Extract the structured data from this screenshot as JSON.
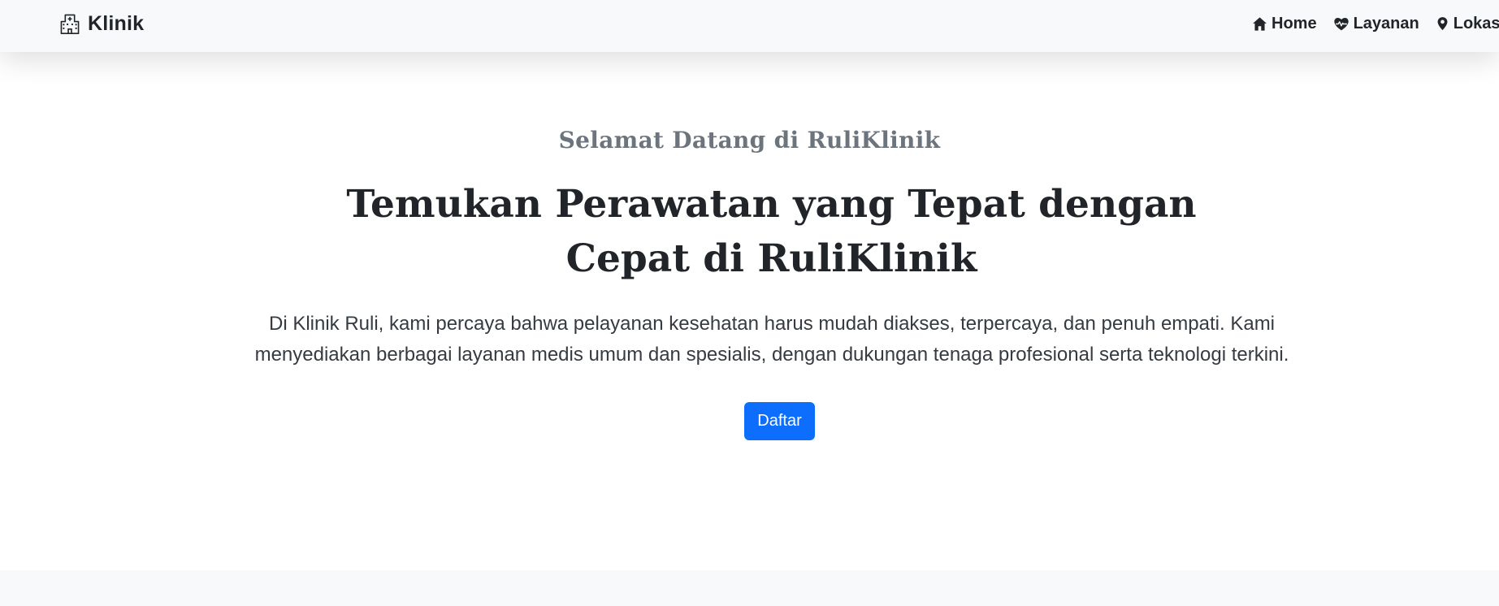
{
  "navbar": {
    "brand": {
      "label": "Klinik",
      "icon": "hospital-icon"
    },
    "items": [
      {
        "label": "Home",
        "icon": "house-icon"
      },
      {
        "label": "Layanan",
        "icon": "heart-pulse-icon"
      },
      {
        "label": "Lokasi",
        "icon": "geo-pin-icon"
      }
    ]
  },
  "hero": {
    "kicker": "Selamat Datang di RuliKlinik",
    "headline": "Temukan Perawatan yang Tepat dengan Cepat di RuliKlinik",
    "lead": "Di Klinik Ruli, kami percaya bahwa pelayanan kesehatan harus mudah diakses, terpercaya, dan penuh empati. Kami menyediakan berbagai layanan medis umum dan spesialis, dengan dukungan tenaga profesional serta teknologi terkini.",
    "cta_label": "Daftar"
  },
  "colors": {
    "primary": "#0d6efd",
    "navbar_bg": "#f8f9fa",
    "text": "#212529",
    "muted": "#6c757d"
  }
}
